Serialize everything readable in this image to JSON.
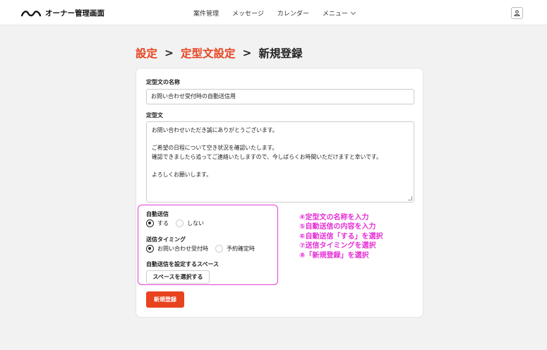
{
  "header": {
    "logo_text": "オーナー管理画面",
    "nav": [
      "案件管理",
      "メッセージ",
      "カレンダー",
      "メニュー"
    ],
    "user_icon": "user-icon"
  },
  "breadcrumb": {
    "item1": "設定",
    "item2": "定型文設定",
    "current": "新規登録",
    "separator": ">"
  },
  "form": {
    "name_label": "定型文の名称",
    "name_value": "お問い合わせ受付時の自動送信用",
    "body_label": "定型文",
    "body_lines": [
      "お問い合わせいただき誠にありがとうございます。",
      "",
      "ご希望の日程について空き状況を確認いたします。",
      "確認できましたら追ってご連絡いたしますので、今しばらくお時間いただけますと幸いです。",
      "",
      "よろしくお願いします。"
    ],
    "auto_send_label": "自動送信",
    "auto_send_options": [
      "する",
      "しない"
    ],
    "auto_send_selected": "する",
    "timing_label": "送信タイミング",
    "timing_options": [
      "お問い合わせ受付時",
      "予約確定時"
    ],
    "timing_selected": "お問い合わせ受付時",
    "space_label": "自動送信を設定するスペース",
    "space_button": "スペースを選択する",
    "submit_button": "新規登録"
  },
  "annotations": [
    "④定型文の名称を入力",
    "⑤自動送信の内容を入力",
    "⑥自動送信「する」を選択",
    "⑦送信タイミングを選択",
    "⑧「新規登録」を選択"
  ],
  "colors": {
    "accent": "#e8431f",
    "annotation": "#e62fd6",
    "background": "#f2f2f2"
  }
}
